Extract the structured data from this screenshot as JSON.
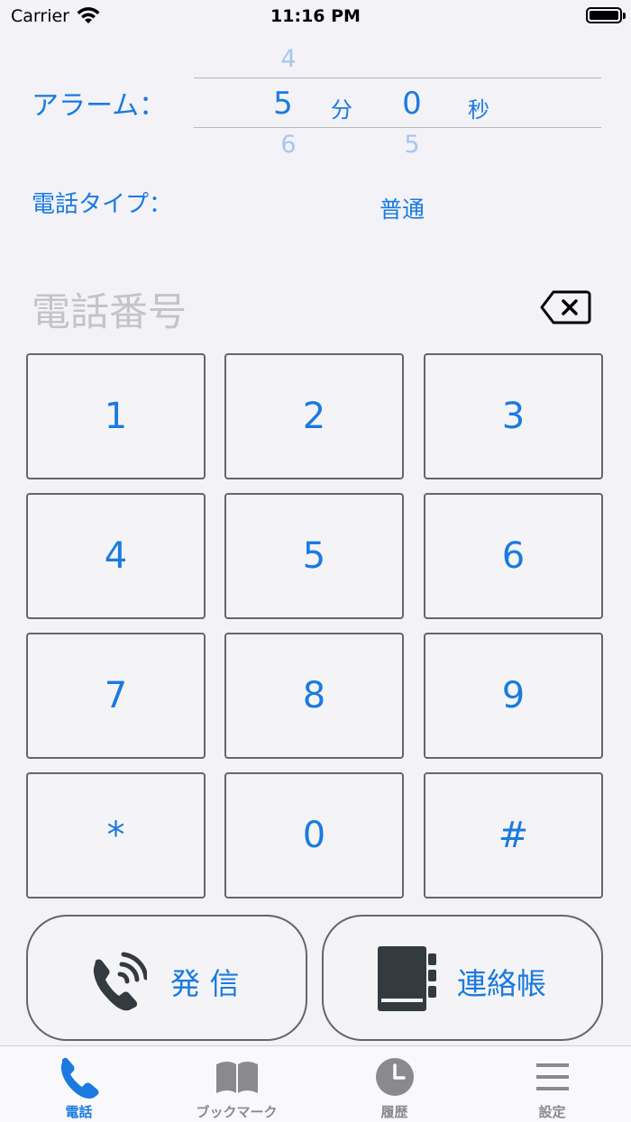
{
  "status_bar": {
    "carrier": "Carrier",
    "time": "11:16 PM"
  },
  "alarm": {
    "label": "アラーム：",
    "minutes": {
      "prev": "4",
      "selected": "5",
      "next": "6",
      "unit": "分"
    },
    "seconds": {
      "selected": "0",
      "next": "5",
      "unit": "秒"
    }
  },
  "phone_type": {
    "label": "電話タイプ：",
    "value": "普通"
  },
  "number_display": {
    "placeholder": "電話番号"
  },
  "keypad": {
    "keys": [
      "1",
      "2",
      "3",
      "4",
      "5",
      "6",
      "7",
      "8",
      "9",
      "*",
      "0",
      "#"
    ]
  },
  "actions": {
    "call_label": "発 信",
    "contacts_label": "連絡帳"
  },
  "tabs": [
    {
      "label": "電話",
      "icon": "phone-icon",
      "active": true
    },
    {
      "label": "ブックマーク",
      "icon": "book-icon",
      "active": false
    },
    {
      "label": "履歴",
      "icon": "clock-icon",
      "active": false
    },
    {
      "label": "設定",
      "icon": "menu-icon",
      "active": false
    }
  ],
  "colors": {
    "accent": "#1a7ae0",
    "inactive": "#8a8a8e",
    "background": "#f2f2f7",
    "icon_dark": "#333a40"
  }
}
